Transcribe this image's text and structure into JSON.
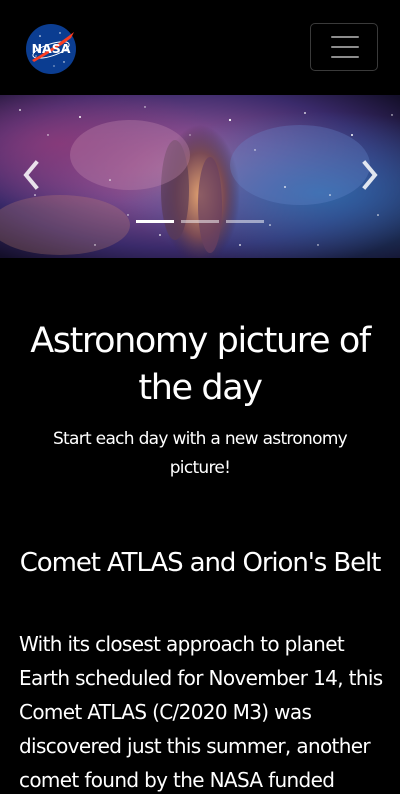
{
  "navbar": {
    "logo_text": "NASA",
    "toggle_icon": "hamburger-icon"
  },
  "carousel": {
    "prev_icon": "chevron-left-icon",
    "next_icon": "chevron-right-icon",
    "slide_count": 3,
    "active_slide": 1
  },
  "hero": {
    "title": "Astronomy picture of the day",
    "subtitle": "Start each day with a new astronomy picture!"
  },
  "apod": {
    "title": "Comet ATLAS and Orion's Belt",
    "description": "With its closest approach to planet Earth scheduled for November 14, this Comet ATLAS (C/2020 M3) was discovered just this summer, another comet found by the NASA funded"
  },
  "colors": {
    "background": "#000000",
    "text": "#ffffff",
    "nasa_blue": "#0b3d91",
    "nasa_red": "#fc3d21"
  }
}
